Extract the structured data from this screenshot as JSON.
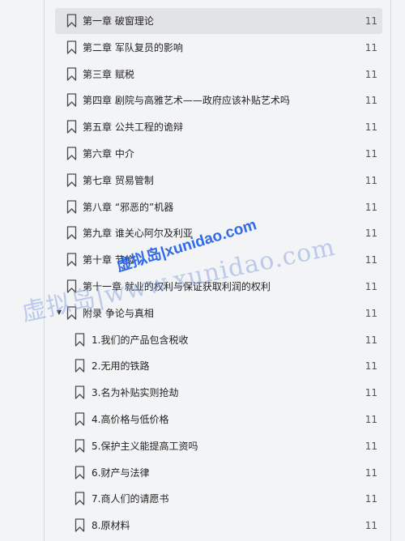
{
  "toc": {
    "items": [
      {
        "label": "第一章 破窗理论",
        "page": "11",
        "level": 0,
        "selected": true,
        "expandable": false
      },
      {
        "label": "第二章 军队复员的影响",
        "page": "11",
        "level": 0,
        "selected": false,
        "expandable": false
      },
      {
        "label": "第三章 赋税",
        "page": "11",
        "level": 0,
        "selected": false,
        "expandable": false
      },
      {
        "label": "第四章 剧院与高雅艺术——政府应该补贴艺术吗",
        "page": "11",
        "level": 0,
        "selected": false,
        "expandable": false
      },
      {
        "label": "第五章 公共工程的诡辩",
        "page": "11",
        "level": 0,
        "selected": false,
        "expandable": false
      },
      {
        "label": "第六章 中介",
        "page": "11",
        "level": 0,
        "selected": false,
        "expandable": false
      },
      {
        "label": "第七章 贸易管制",
        "page": "11",
        "level": 0,
        "selected": false,
        "expandable": false
      },
      {
        "label": "第八章 “邪恶的”机器",
        "page": "11",
        "level": 0,
        "selected": false,
        "expandable": false
      },
      {
        "label": "第九章 谁关心阿尔及利亚",
        "page": "11",
        "level": 0,
        "selected": false,
        "expandable": false
      },
      {
        "label": "第十章 节俭",
        "page": "11",
        "level": 0,
        "selected": false,
        "expandable": false
      },
      {
        "label": "第十一章 就业的权利与保证获取利润的权利",
        "page": "11",
        "level": 0,
        "selected": false,
        "expandable": false
      },
      {
        "label": "附录 争论与真相",
        "page": "11",
        "level": 0,
        "selected": false,
        "expandable": true
      },
      {
        "label": "1.我们的产品包含税收",
        "page": "11",
        "level": 1,
        "selected": false,
        "expandable": false
      },
      {
        "label": "2.无用的铁路",
        "page": "11",
        "level": 1,
        "selected": false,
        "expandable": false
      },
      {
        "label": "3.名为补贴实则抢劫",
        "page": "11",
        "level": 1,
        "selected": false,
        "expandable": false
      },
      {
        "label": "4.高价格与低价格",
        "page": "11",
        "level": 1,
        "selected": false,
        "expandable": false
      },
      {
        "label": "5.保护主义能提高工资吗",
        "page": "11",
        "level": 1,
        "selected": false,
        "expandable": false
      },
      {
        "label": "6.财产与法律",
        "page": "11",
        "level": 1,
        "selected": false,
        "expandable": false
      },
      {
        "label": "7.商人们的请愿书",
        "page": "11",
        "level": 1,
        "selected": false,
        "expandable": false
      },
      {
        "label": "8.原材料",
        "page": "11",
        "level": 1,
        "selected": false,
        "expandable": false
      }
    ],
    "expand_glyph": "▼",
    "icon": "bookmark-icon"
  },
  "watermarks": {
    "primary": "虚拟岛|xunidao.com",
    "secondary": "虚拟岛|www.xunidao.com"
  },
  "colors": {
    "background": "#f3f4f6",
    "selected_row": "#e2e3e6",
    "watermark_primary": "#1656e8",
    "watermark_secondary": "#7896dc"
  }
}
